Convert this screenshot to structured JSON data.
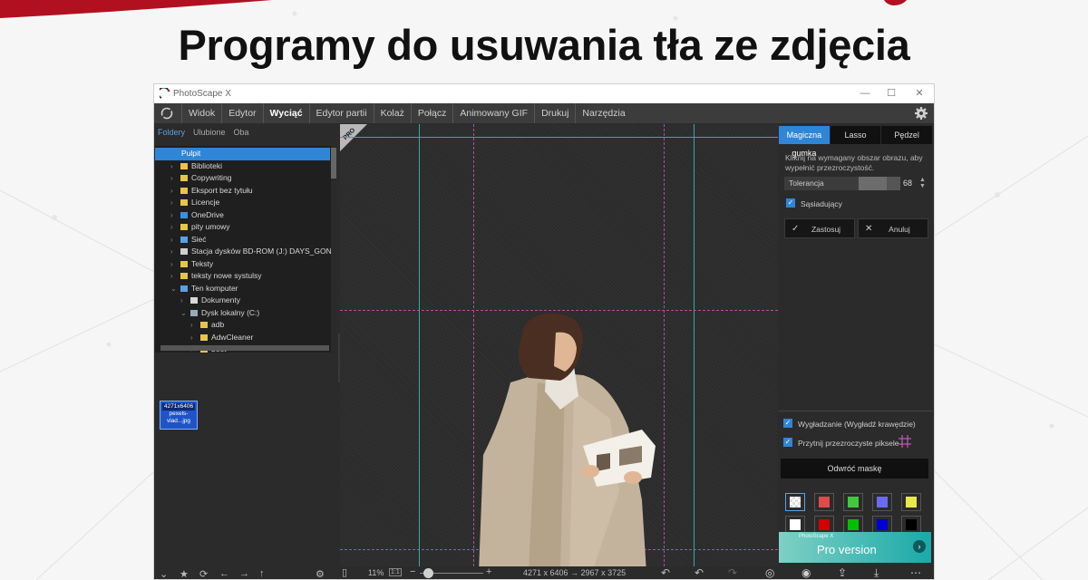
{
  "headline": "Programy do usuwania tła ze zdjęcia",
  "window": {
    "title": "PhotoScape X"
  },
  "menu": {
    "items": [
      "Widok",
      "Edytor",
      "Wyciąć",
      "Edytor partii",
      "Kolaż",
      "Połącz",
      "Animowany GIF",
      "Drukuj",
      "Narzędzia"
    ],
    "active": "Wyciąć"
  },
  "left_panel": {
    "tabs": [
      "Foldery",
      "Ulubione",
      "Oba"
    ],
    "tree": [
      {
        "label": "Pulpit",
        "level": 0,
        "icon": "desktop",
        "selected": true,
        "chevron": ""
      },
      {
        "label": "Biblioteki",
        "level": 1,
        "icon": "library",
        "chevron": "›"
      },
      {
        "label": "Copywriting",
        "level": 1,
        "icon": "folder",
        "chevron": "›"
      },
      {
        "label": "Eksport bez tytułu",
        "level": 1,
        "icon": "folder",
        "chevron": "›"
      },
      {
        "label": "Licencje",
        "level": 1,
        "icon": "folder",
        "chevron": "›"
      },
      {
        "label": "OneDrive",
        "level": 1,
        "icon": "cloud",
        "chevron": "›"
      },
      {
        "label": "pity umowy",
        "level": 1,
        "icon": "folder",
        "chevron": "›"
      },
      {
        "label": "Sieć",
        "level": 1,
        "icon": "network",
        "chevron": "›"
      },
      {
        "label": "Stacja dysków BD-ROM (J:) DAYS_GONE",
        "level": 1,
        "icon": "disc",
        "chevron": "›"
      },
      {
        "label": "Teksty",
        "level": 1,
        "icon": "folder",
        "chevron": "›"
      },
      {
        "label": "teksty nowe systulsy",
        "level": 1,
        "icon": "folder",
        "chevron": "›"
      },
      {
        "label": "Ten komputer",
        "level": 1,
        "icon": "computer",
        "chevron": "⌄"
      },
      {
        "label": "Dokumenty",
        "level": 2,
        "icon": "document",
        "chevron": "›"
      },
      {
        "label": "Dysk lokalny (C:)",
        "level": 2,
        "icon": "drive",
        "chevron": "⌄"
      },
      {
        "label": "adb",
        "level": 3,
        "icon": "folder",
        "chevron": "›"
      },
      {
        "label": "AdwCleaner",
        "level": 3,
        "icon": "folder",
        "chevron": "›"
      },
      {
        "label": "boot",
        "level": 3,
        "icon": "folder",
        "chevron": "›"
      }
    ],
    "thumbnail": {
      "resolution": "4271x6406",
      "filename_line1": "pexels-",
      "filename_line2": "vlad...jpg"
    }
  },
  "canvas": {
    "badge": "PRO"
  },
  "status": {
    "zoom": "11%",
    "ratio": "1:1",
    "minus": "−",
    "plus": "+",
    "dimensions": "4271 x 6406 → 2967 x 3725"
  },
  "right_panel": {
    "tabs": [
      "Magiczna gumka",
      "Lasso",
      "Pędzel"
    ],
    "active_tab": "Magiczna gumka",
    "hint": "Kliknij na wymagany obszar obrazu, aby wypełnić przezroczystość.",
    "tolerance_label": "Tolerancja",
    "tolerance_value": "68",
    "tolerance_fraction": 0.68,
    "adjacent_label": "Sąsiadujący",
    "apply_label": "Zastosuj",
    "cancel_label": "Anuluj",
    "smooth_label": "Wygładzanie (Wygładź krawędzie)",
    "trim_label": "Przytnij przezroczyste piksele",
    "invert_mask_label": "Odwróć maskę",
    "swatches": [
      "transparent",
      "#e04a4a",
      "#3ec93e",
      "#6a6af2",
      "#e9e94a",
      "#ffffff",
      "#d40000",
      "#00c000",
      "#0000d4",
      "#000000"
    ],
    "pro_small": "PhotoScape X",
    "pro_label": "Pro version"
  },
  "colors": {
    "accent": "#2f86d6",
    "brand_red": "#b01020",
    "guide_magenta": "#b44ba6",
    "guide_cyan": "#3aa7a7"
  }
}
